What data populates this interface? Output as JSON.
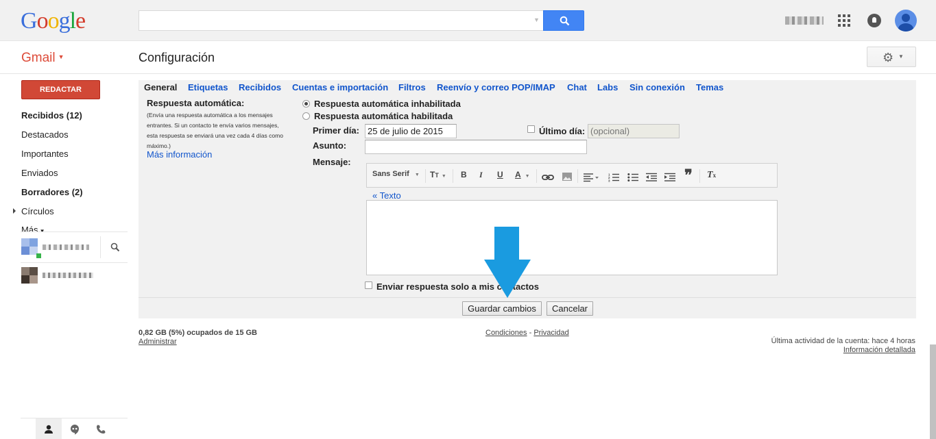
{
  "header": {
    "logo": [
      "G",
      "o",
      "o",
      "g",
      "l",
      "e"
    ],
    "logo_colors": [
      "#3b6fdb",
      "#d43c2b",
      "#f0b400",
      "#3b6fdb",
      "#18a53a",
      "#d43c2b"
    ],
    "search_value": "",
    "icons": {
      "search": "search-icon",
      "apps": "apps-icon",
      "notifications": "bell-icon",
      "account": "avatar"
    }
  },
  "subbar": {
    "app_label": "Gmail",
    "page_title": "Configuración",
    "settings_icon": "gear-icon"
  },
  "nav": {
    "compose": "REDACTAR",
    "items": [
      {
        "label": "Recibidos (12)",
        "bold": true
      },
      {
        "label": "Destacados",
        "bold": false
      },
      {
        "label": "Importantes",
        "bold": false
      },
      {
        "label": "Enviados",
        "bold": false
      },
      {
        "label": "Borradores (2)",
        "bold": true
      },
      {
        "label": "Círculos",
        "bold": false
      }
    ],
    "more": "Más"
  },
  "settings": {
    "tabs": [
      "General",
      "Etiquetas",
      "Recibidos",
      "Cuentas e importación",
      "Filtros",
      "Reenvío y correo POP/IMAP",
      "Chat",
      "Labs",
      "Sin conexión",
      "Temas"
    ],
    "active_tab": 0,
    "vacation": {
      "title": "Respuesta automática:",
      "description": "(Envía una respuesta automática a los mensajes entrantes. Si un contacto te envía varios mensajes, esta respuesta se enviará una vez cada 4 días como máximo.)",
      "more_info": "Más información",
      "option_off": "Respuesta automática inhabilitada",
      "option_on": "Respuesta automática habilitada",
      "selected": "off",
      "first_day_label": "Primer día:",
      "first_day_value": "25 de julio de 2015",
      "last_day_label": "Último día:",
      "last_day_placeholder": "(opcional)",
      "subject_label": "Asunto:",
      "subject_value": "",
      "message_label": "Mensaje:",
      "font_name": "Sans Serif",
      "text_link": "«  Texto",
      "contacts_only_label": "Enviar respuesta solo a mis contactos"
    },
    "save_button": "Guardar cambios",
    "cancel_button": "Cancelar"
  },
  "footer": {
    "storage": "0,82 GB (5%) ocupados de 15 GB",
    "manage": "Administrar",
    "terms": "Condiciones",
    "separator": "-",
    "privacy": "Privacidad",
    "last_activity": "Última actividad de la cuenta: hace 4 horas",
    "details": "Información detallada"
  },
  "colors": {
    "accent": "#4285f4",
    "compose": "#d14836",
    "gmail_red": "#dd4b39",
    "link": "#1155cc",
    "arrow": "#1a9be0"
  }
}
